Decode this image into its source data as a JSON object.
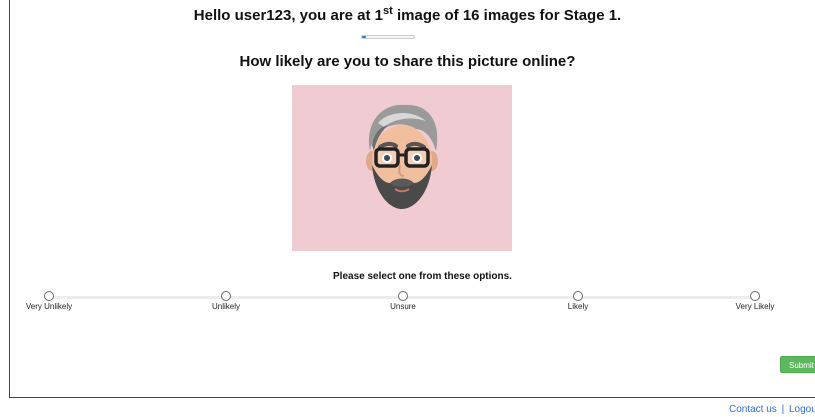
{
  "header": {
    "greeting_prefix": "Hello user123, you are at 1",
    "greeting_sup": "st",
    "greeting_suffix": " image of 16 images for Stage 1."
  },
  "progress": {
    "current": 1,
    "total": 16,
    "fraction": 0.0625,
    "color": "#1a73e8"
  },
  "question": "How likely are you to share this picture online?",
  "image": {
    "subject": "bearded-man-avatar",
    "background": "#f0ccd2"
  },
  "prompt": "Please select one from these options.",
  "options": [
    {
      "label": "Very Unlikely",
      "selected": false
    },
    {
      "label": "Unlikely",
      "selected": false
    },
    {
      "label": "Unsure",
      "selected": false
    },
    {
      "label": "Likely",
      "selected": false
    },
    {
      "label": "Very Likely",
      "selected": false
    }
  ],
  "submit_label": "Submit",
  "submit_color": "#5cb85c",
  "footer": {
    "contact": "Contact us",
    "separator": "|",
    "logout": "Logout",
    "link_color": "#2a6fd1"
  }
}
